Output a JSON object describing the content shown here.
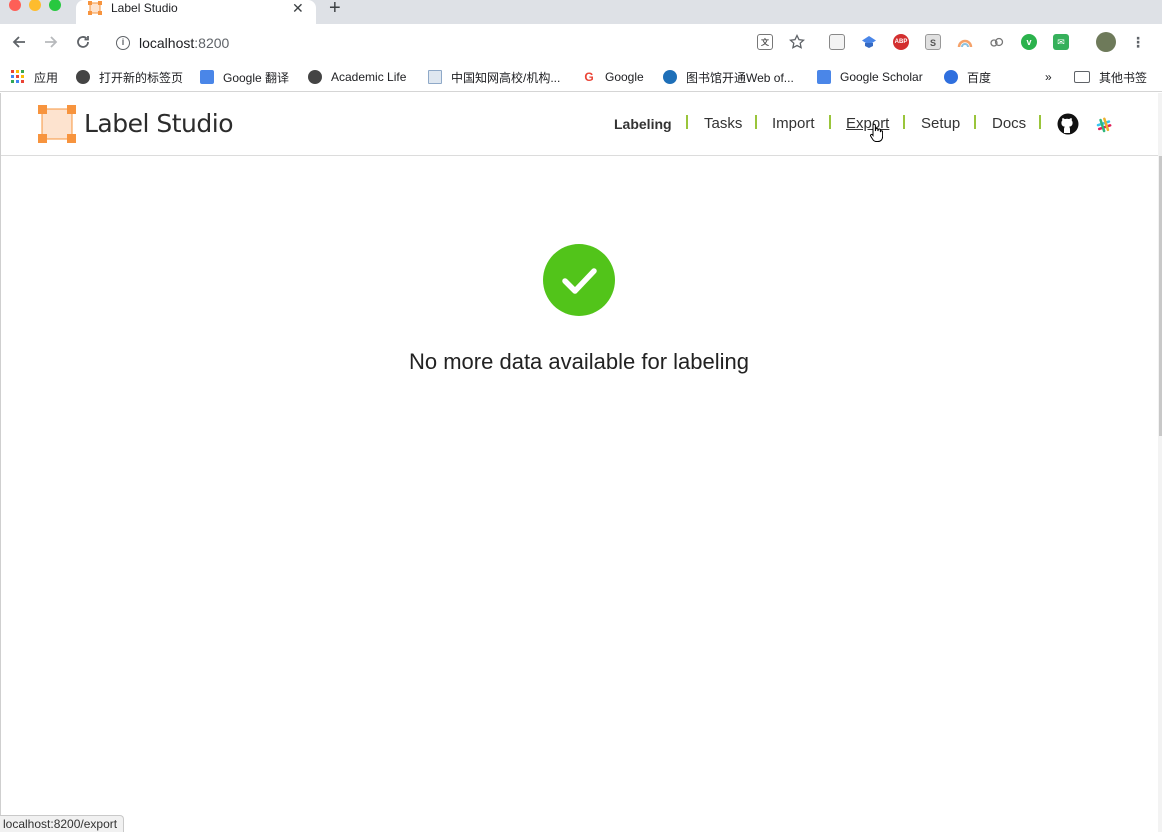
{
  "browser": {
    "tab_title": "Label Studio",
    "tab_close": "✕",
    "new_tab": "+",
    "url_host": "localhost",
    "url_port": ":8200",
    "status_url": "localhost:8200/export",
    "extensions": [
      "translate-icon",
      "star-icon",
      "page-icon",
      "scholar-cap-icon",
      "abp-icon",
      "s-icon",
      "rainbow-icon",
      "cloud-icon",
      "vue-icon",
      "chat-icon",
      "avatar-icon",
      "menu-icon"
    ]
  },
  "bookmarks": {
    "apps": "应用",
    "items": [
      {
        "label": "打开新的标签页",
        "color": "#444444"
      },
      {
        "label": "Google 翻译",
        "color": "#4a86e8"
      },
      {
        "label": "Academic Life",
        "color": "#444444"
      },
      {
        "label": "中国知网高校/机构...",
        "color": "#8fa9c8"
      },
      {
        "label": "Google",
        "color": "#ea4335"
      },
      {
        "label": "图书馆开通Web of...",
        "color": "#1e6fb8"
      },
      {
        "label": "Google Scholar",
        "color": "#4a86e8"
      },
      {
        "label": "百度",
        "color": "#2f6fde"
      }
    ],
    "more": "»",
    "other": "其他书签"
  },
  "app": {
    "logo_text": "Label Studio",
    "nav": {
      "labeling": "Labeling",
      "tasks": "Tasks",
      "import": "Import",
      "export": "Export",
      "setup": "Setup",
      "docs": "Docs"
    },
    "message": "No more data available for labeling",
    "colors": {
      "accent": "#f7943e",
      "separator": "#9ac53b",
      "success": "#52c41a"
    }
  }
}
